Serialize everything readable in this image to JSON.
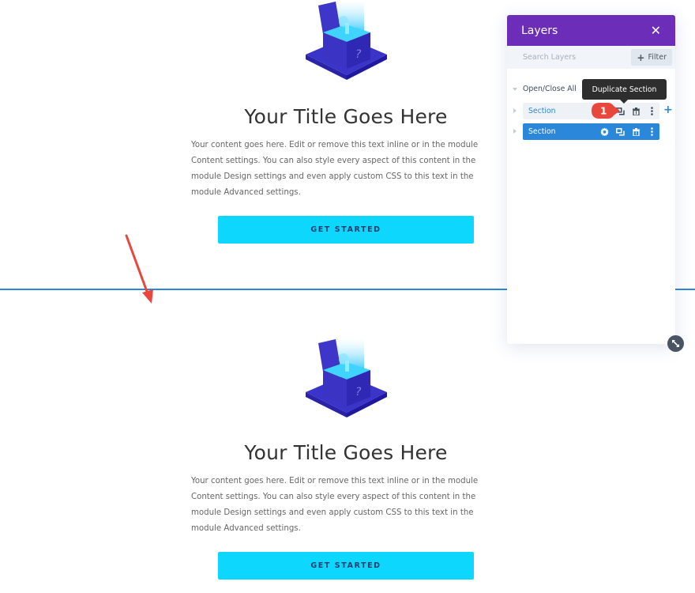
{
  "sections": [
    {
      "title": "Your Title Goes Here",
      "body": "Your content goes here. Edit or remove this text inline or in the module Content settings. You can also style every aspect of this content in the module Design settings and even apply custom CSS to this text in the module Advanced settings.",
      "button_label": "GET STARTED",
      "image_icon": "question-box-illustration"
    },
    {
      "title": "Your Title Goes Here",
      "body": "Your content goes here. Edit or remove this text inline or in the module Content settings. You can also style every aspect of this content in the module Design settings and even apply custom CSS to this text in the module Advanced settings.",
      "button_label": "GET STARTED",
      "image_icon": "question-box-illustration"
    }
  ],
  "colors": {
    "button_bg": "#0dd7fd",
    "button_text": "#1a3f6e",
    "divider": "#2b87da",
    "panel_header": "#6c2eb9",
    "layer_active": "#2b87da",
    "annotation": "#e8473c"
  },
  "layers_panel": {
    "title": "Layers",
    "close_icon": "close-icon",
    "search_placeholder": "Search Layers",
    "filter_label": "Filter",
    "open_close_all": "Open/Close All",
    "tooltip": "Duplicate Section",
    "step_badge": "1",
    "layers": [
      {
        "label": "Section",
        "state": "hovered",
        "actions": [
          "duplicate-icon",
          "trash-icon",
          "more-icon"
        ]
      },
      {
        "label": "Section",
        "state": "selected",
        "actions": [
          "gear-icon",
          "duplicate-icon",
          "trash-icon",
          "more-icon"
        ]
      }
    ],
    "add_icon": "plus-icon",
    "resize_icon": "resize-icon"
  }
}
